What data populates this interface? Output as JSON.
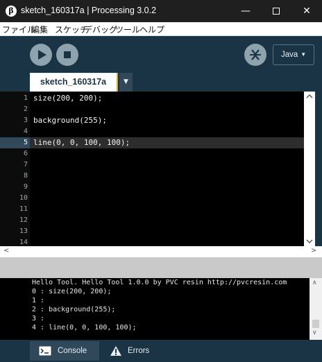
{
  "window": {
    "title": "sketch_160317a | Processing 3.0.2",
    "app_icon_glyph": "β",
    "controls": {
      "minimize": "—",
      "maximize": "☐",
      "close": "✕"
    }
  },
  "menu": [
    "ファイル",
    "編集",
    "スケッチ",
    "デバッグ",
    "ツール",
    "ヘルプ"
  ],
  "toolbar": {
    "run_icon": "play-icon",
    "stop_icon": "stop-icon",
    "debug_icon": "debugger-icon",
    "mode_label": "Java",
    "mode_arrow": "▼"
  },
  "tabs": {
    "active": "sketch_160317a",
    "menu_arrow": "▼"
  },
  "editor": {
    "current_line": 5,
    "line_numbers": [
      "1",
      "2",
      "3",
      "4",
      "5",
      "6",
      "7",
      "8",
      "9",
      "10",
      "11",
      "12",
      "13",
      "14"
    ],
    "lines": [
      "size(200, 200);",
      "",
      "background(255);",
      "",
      "line(0, 0, 100, 100);"
    ]
  },
  "scrollbars": {
    "left": "<",
    "right": ">",
    "up": "∧",
    "down": "∨"
  },
  "console": {
    "lines": [
      "Hello Tool. Hello Tool 1.0.0 by PVC resin http://pvcresin.com",
      "0 : size(200, 200);",
      "1 :",
      "2 : background(255);",
      "3 :",
      "4 : line(0, 0, 100, 100);"
    ]
  },
  "footer": {
    "console_label": "Console",
    "errors_label": "Errors"
  },
  "colors": {
    "toolbar_bg": "#1a3345",
    "accent": "#e5a824",
    "tab_text": "#1a3345",
    "button": "#8fa3ae"
  }
}
